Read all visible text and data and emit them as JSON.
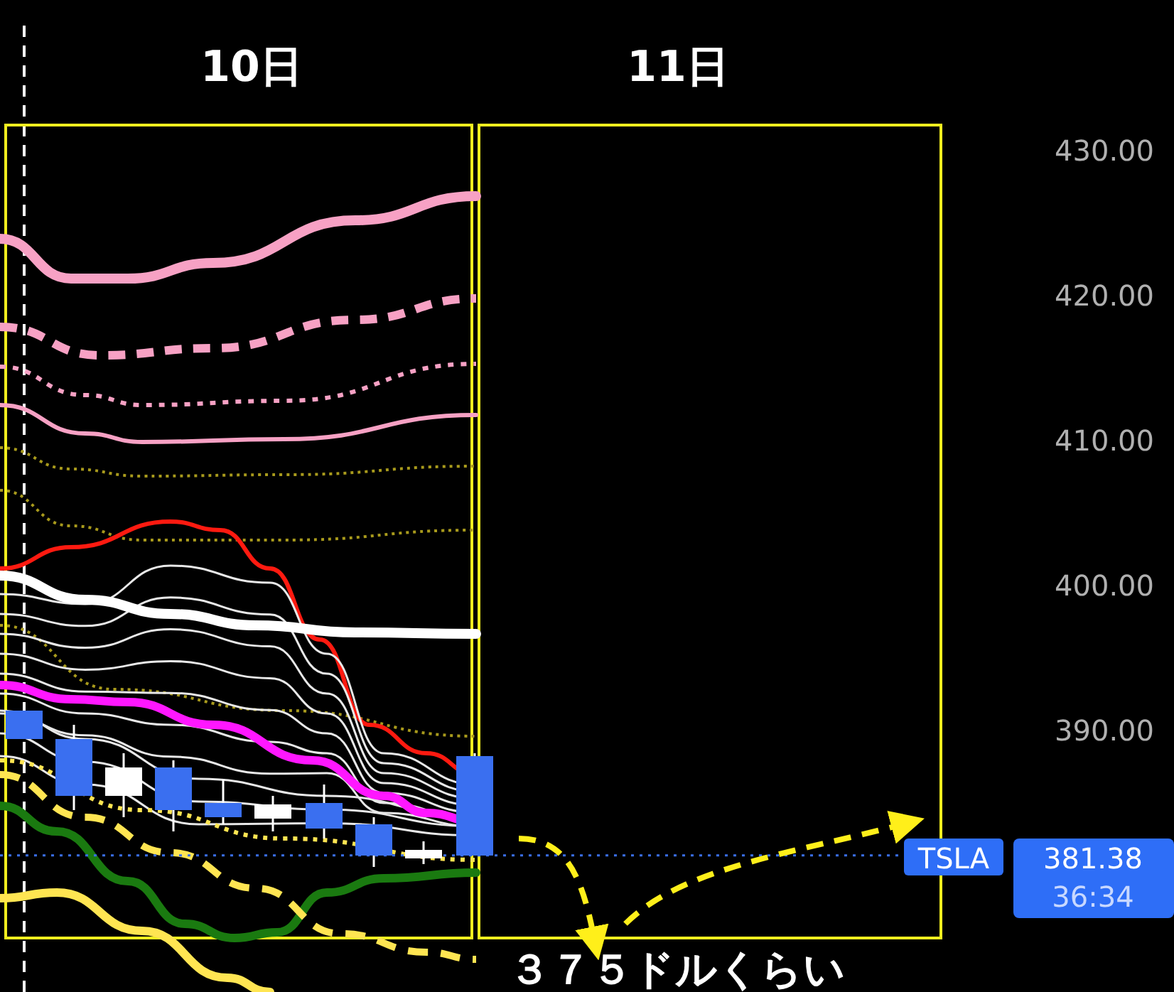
{
  "day_labels": [
    "10日",
    "11日"
  ],
  "price_axis": {
    "labels": [
      "430.00",
      "420.00",
      "410.00",
      "400.00",
      "390.00"
    ]
  },
  "price_tag": {
    "symbol": "TSLA",
    "price": "381.38",
    "countdown": "36:34"
  },
  "annotation": {
    "text": "３７５ドルくらい"
  }
}
